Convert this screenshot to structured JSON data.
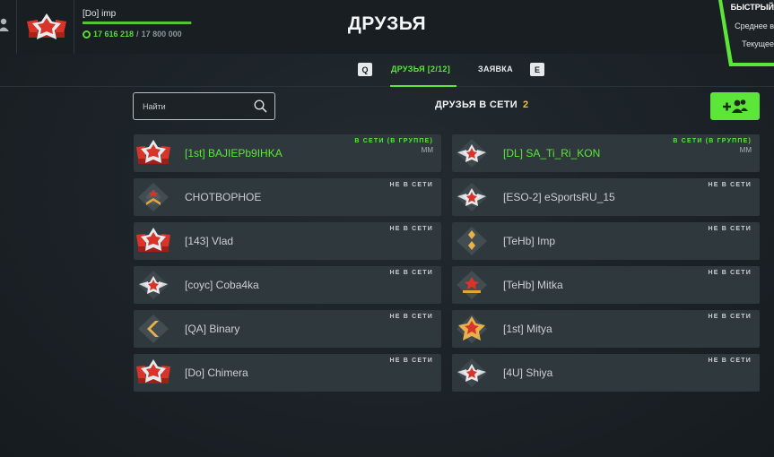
{
  "profile": {
    "name": "[Do] imp",
    "xp_current": "17 616 218",
    "xp_separator": "/",
    "xp_max": "17 800 000",
    "xp_progress": 0.99
  },
  "page": {
    "title": "ДРУЗЬЯ"
  },
  "promo": {
    "title": "БЫСТРЫЙ",
    "line1": "Среднее в",
    "line2": "Текущее"
  },
  "tabs": {
    "key_left": "Q",
    "friends": "ДРУЗЬЯ [2/12]",
    "requests": "ЗАЯВКА",
    "key_right": "E"
  },
  "search": {
    "placeholder": "Найти"
  },
  "online_header": {
    "label": "ДРУЗЬЯ В СЕТИ",
    "count": "2"
  },
  "colors": {
    "accent": "#5ce63a",
    "count": "#f5c518",
    "card": "#2f383d"
  },
  "friends": [
    {
      "name": "[1st] BAJIEPb9IHKA",
      "status": "В СЕТИ (В ГРУППЕ)",
      "mode": "ММ",
      "online": true,
      "rank_icon": "wings-star-rank-icon"
    },
    {
      "name": "[DL] SA_Ti_Ri_KON",
      "status": "В СЕТИ (В ГРУППЕ)",
      "mode": "ММ",
      "online": true,
      "rank_icon": "winged-star-rank-icon"
    },
    {
      "name": "CHOTBOPHOE",
      "status": "НЕ В СЕТИ",
      "mode": "",
      "online": false,
      "rank_icon": "diamond-chevron-rank-icon"
    },
    {
      "name": "[ESO-2] eSportsRU_15",
      "status": "НЕ В СЕТИ",
      "mode": "",
      "online": false,
      "rank_icon": "winged-star-rank-icon"
    },
    {
      "name": "[143] Vlad",
      "status": "НЕ В СЕТИ",
      "mode": "",
      "online": false,
      "rank_icon": "wings-star-rank-icon"
    },
    {
      "name": "[TeHb] Imp",
      "status": "НЕ В СЕТИ",
      "mode": "",
      "online": false,
      "rank_icon": "diamond-pips-rank-icon"
    },
    {
      "name": "[coyc] Coba4ka",
      "status": "НЕ В СЕТИ",
      "mode": "",
      "online": false,
      "rank_icon": "winged-star-rank-icon"
    },
    {
      "name": "[TeHb] Mitka",
      "status": "НЕ В СЕТИ",
      "mode": "",
      "online": false,
      "rank_icon": "diamond-bar-rank-icon"
    },
    {
      "name": "[QA] Binary",
      "status": "НЕ В СЕТИ",
      "mode": "",
      "online": false,
      "rank_icon": "diamond-chevron-gold-rank-icon"
    },
    {
      "name": "[1st] Mitya",
      "status": "НЕ В СЕТИ",
      "mode": "",
      "online": false,
      "rank_icon": "gold-star-rank-icon"
    },
    {
      "name": "[Do] Chimera",
      "status": "НЕ В СЕТИ",
      "mode": "",
      "online": false,
      "rank_icon": "wings-star-rank-icon"
    },
    {
      "name": "[4U] Shiya",
      "status": "НЕ В СЕТИ",
      "mode": "",
      "online": false,
      "rank_icon": "winged-star-rank-icon"
    }
  ]
}
